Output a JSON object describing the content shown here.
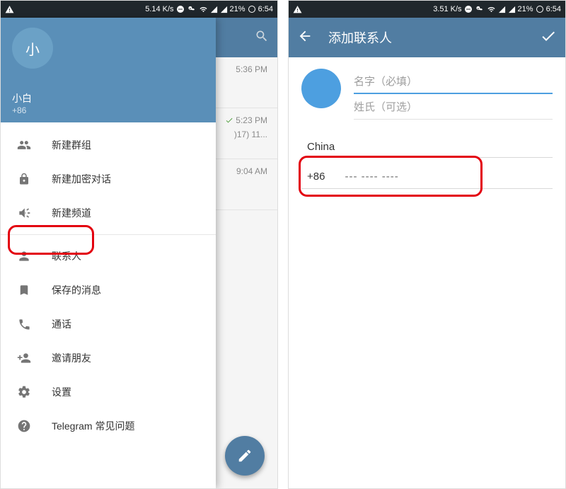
{
  "statusbar": {
    "left_speed_a": "5.14 K/s",
    "left_speed_b": "3.51 K/s",
    "battery": "21%",
    "time": "6:54"
  },
  "left_screen": {
    "chat_times": [
      "5:36 PM",
      "5:23 PM",
      "9:04 AM"
    ],
    "chat_snippet": ")17) 11...",
    "drawer": {
      "avatar_initial": "小",
      "user_name": "小白",
      "user_phone": "+86",
      "items": [
        {
          "id": "new-group",
          "label": "新建群组"
        },
        {
          "id": "new-secret",
          "label": "新建加密对话"
        },
        {
          "id": "new-channel",
          "label": "新建频道"
        },
        {
          "id": "contacts",
          "label": "联系人"
        },
        {
          "id": "saved",
          "label": "保存的消息"
        },
        {
          "id": "calls",
          "label": "通话"
        },
        {
          "id": "invite",
          "label": "邀请朋友"
        },
        {
          "id": "settings",
          "label": "设置"
        },
        {
          "id": "faq",
          "label": "Telegram 常见问题"
        }
      ]
    }
  },
  "right_screen": {
    "title": "添加联系人",
    "first_name_placeholder": "名字（必填）",
    "last_name_placeholder": "姓氏（可选）",
    "country": "China",
    "phone_code": "+86",
    "phone_placeholder": "--- ---- ----"
  }
}
